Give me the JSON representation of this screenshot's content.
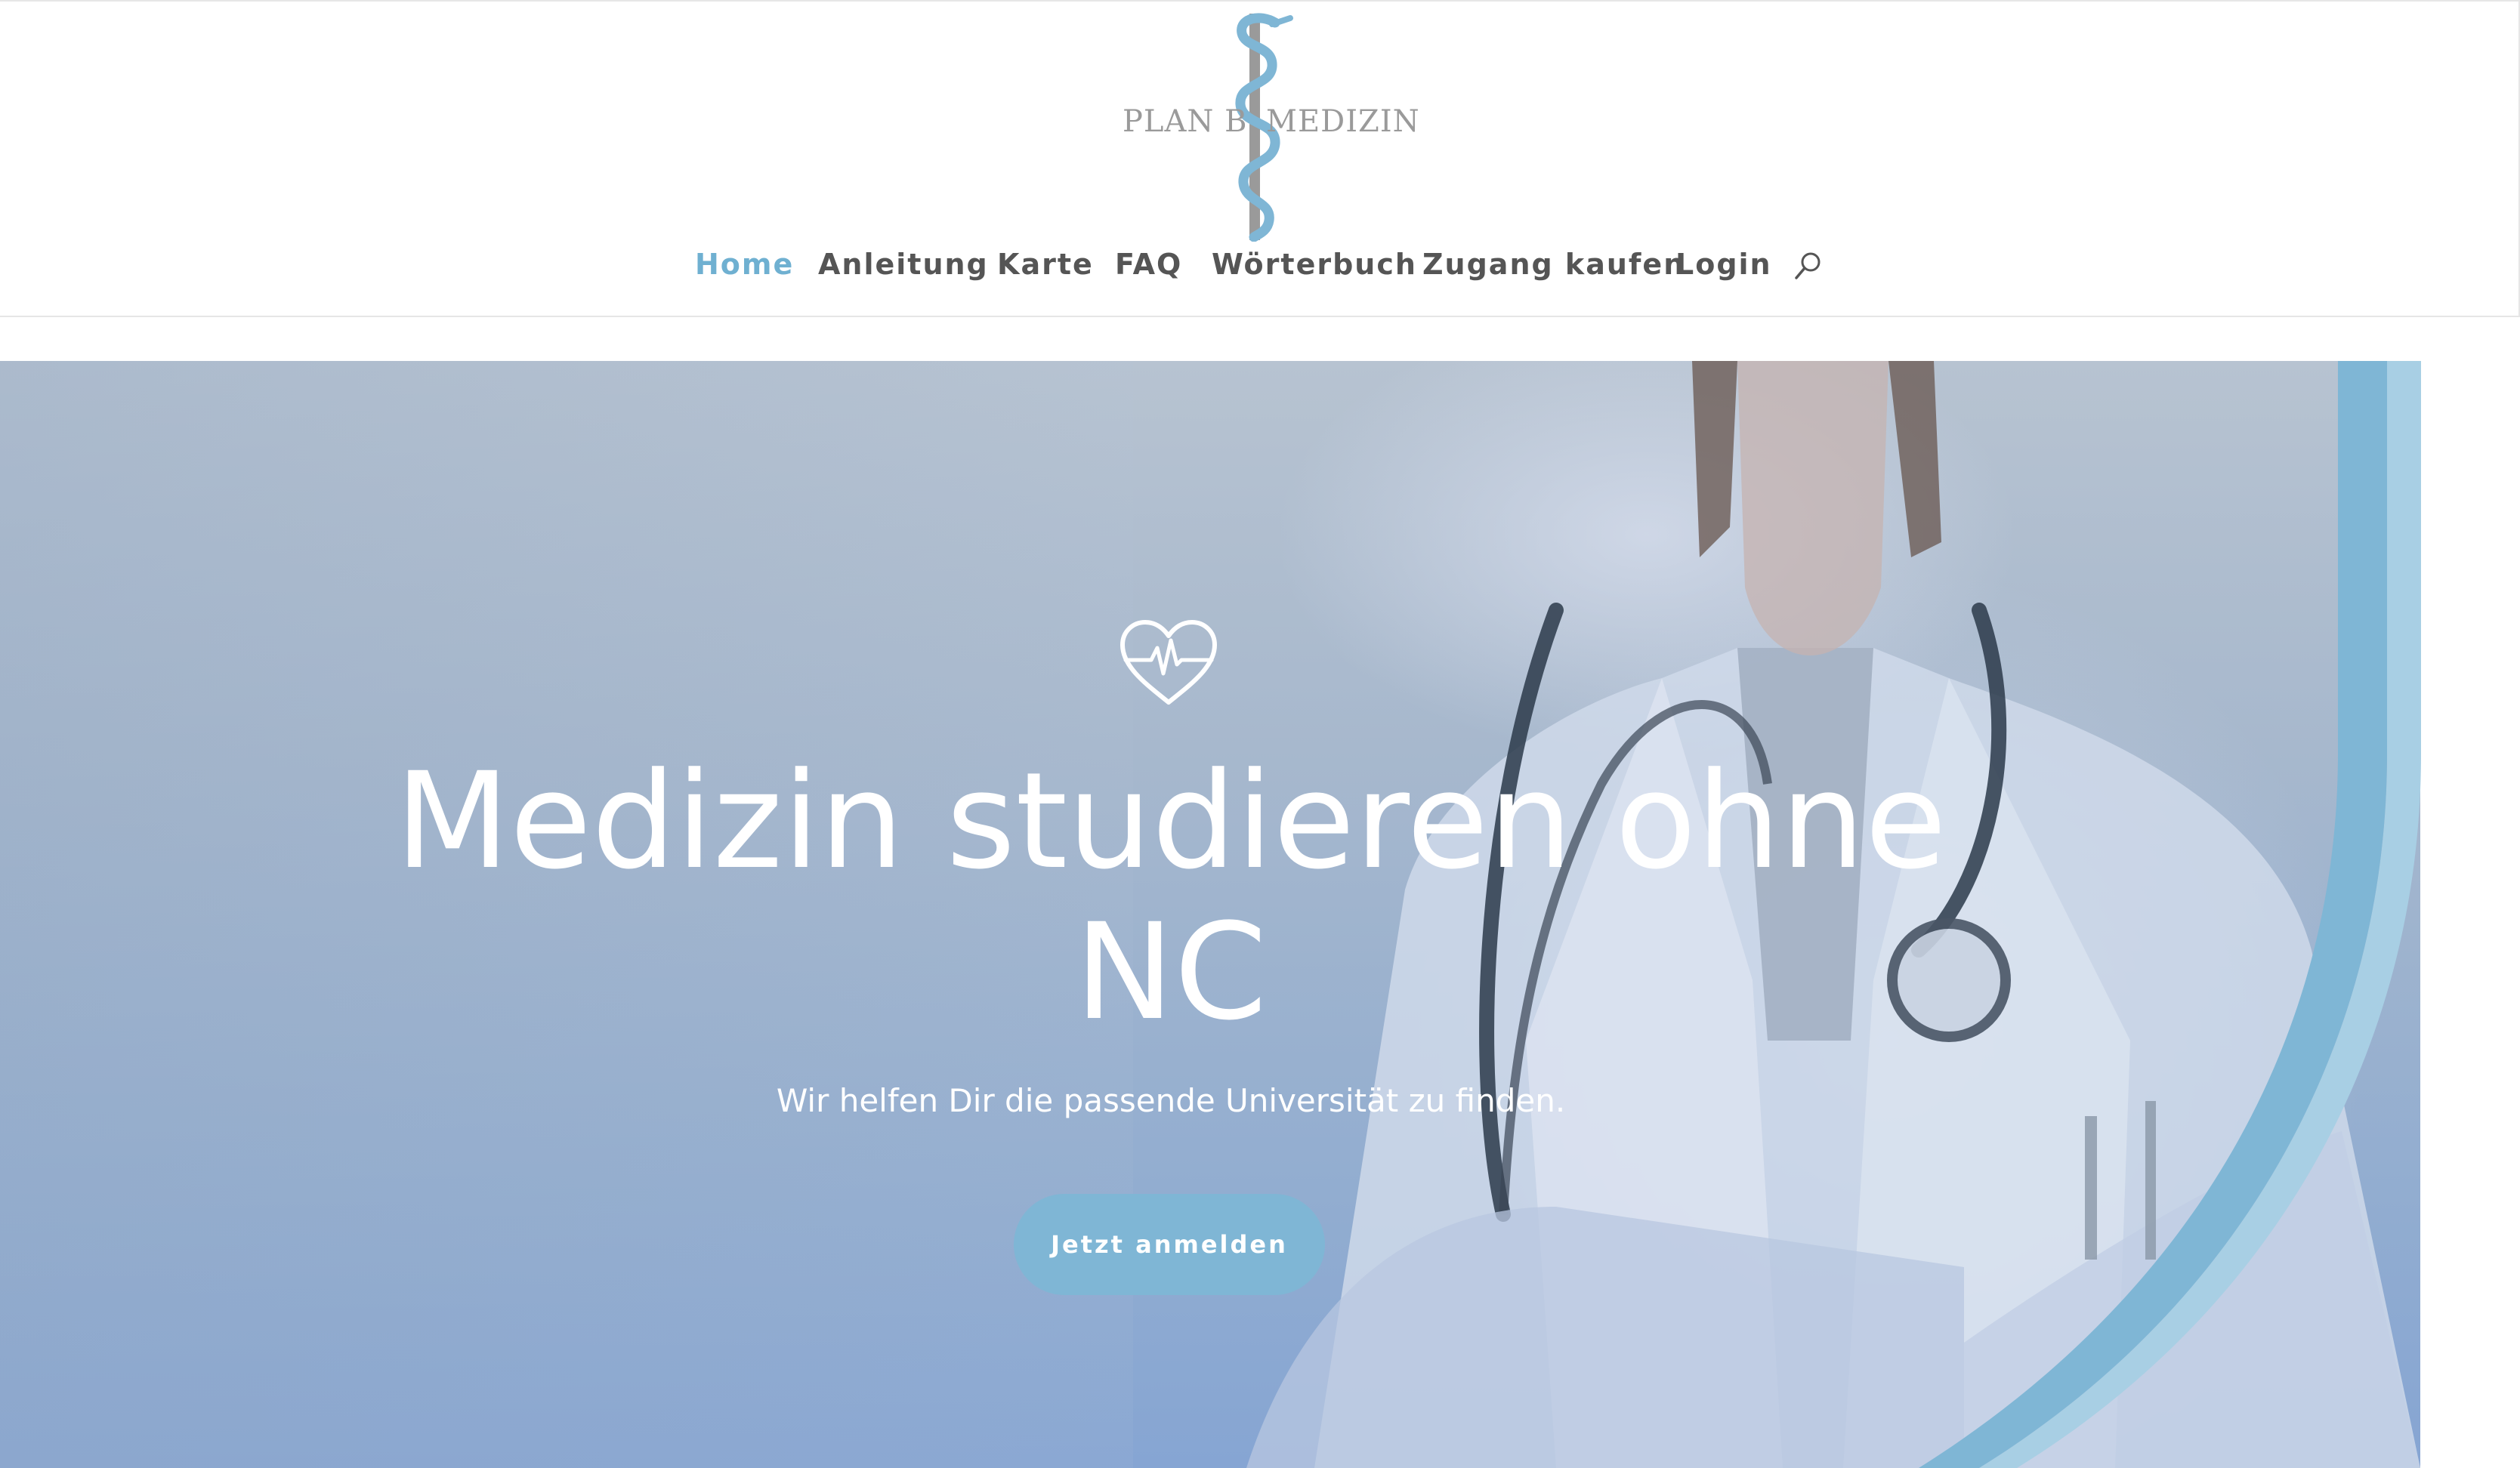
{
  "brand": {
    "name_left": "PLAN B",
    "name_right": "MEDIZIN",
    "logo_colors": {
      "staff": "#9a9a9a",
      "snake": "#7fb6d5",
      "text": "#9a9a9a"
    }
  },
  "nav": {
    "items": [
      {
        "label": "Home",
        "active": true
      },
      {
        "label": "Anleitung",
        "active": false
      },
      {
        "label": "Karte",
        "active": false
      },
      {
        "label": "FAQ",
        "active": false
      },
      {
        "label": "Wörterbuch",
        "active": false
      },
      {
        "label": "Zugang kaufen",
        "active": false
      },
      {
        "label": "Login",
        "active": false
      }
    ],
    "search_icon": "search-icon",
    "active_color": "#6fb0d1",
    "text_color": "#555555"
  },
  "hero": {
    "icon": "heartbeat-icon",
    "title": "Medizin studieren ohne NC",
    "subtitle": "Wir helfen Dir die passende Universität zu finden.",
    "cta_label": "Jetzt anmelden",
    "accent_color": "#7fb6d5"
  }
}
